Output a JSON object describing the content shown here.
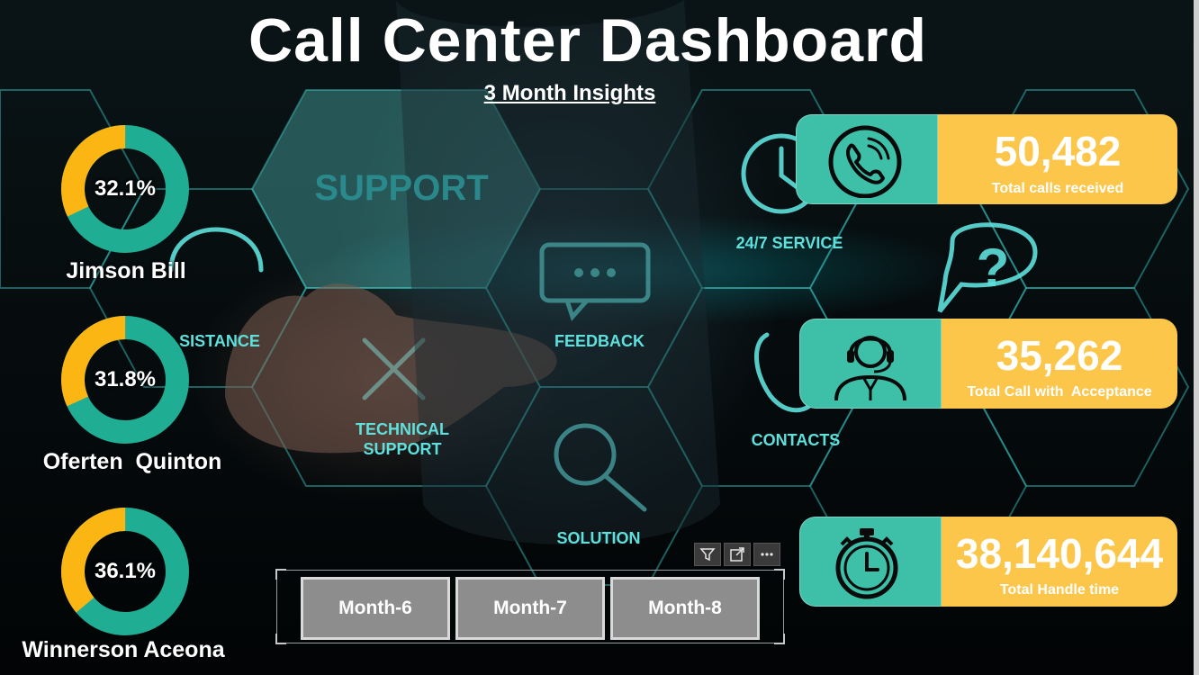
{
  "header": {
    "title": "Call Center Dashboard",
    "subtitle": "3 Month Insights"
  },
  "background_labels": {
    "support": "SUPPORT",
    "service": "24/7 SERVICE",
    "assistance": "SISTANCE",
    "feedback": "FEEDBACK",
    "technical_support_line1": "TECHNICAL",
    "technical_support_line2": "SUPPORT",
    "contacts": "CONTACTS",
    "solution": "SOLUTION"
  },
  "agents": [
    {
      "name": "Jimson Bill",
      "percent_label": "32.1%",
      "percent": 32.1
    },
    {
      "name": "Oferten  Quinton",
      "percent_label": "31.8%",
      "percent": 31.8
    },
    {
      "name": "Winnerson Aceona",
      "percent_label": "36.1%",
      "percent": 36.1
    }
  ],
  "kpis": [
    {
      "value": "50,482",
      "label": "Total calls received",
      "icon": "phone-icon"
    },
    {
      "value": "35,262",
      "label": "Total Call with  Acceptance",
      "icon": "call-agent-icon"
    },
    {
      "value": "38,140,644",
      "label": "Total Handle time",
      "icon": "stopwatch-icon"
    }
  ],
  "slicer": {
    "months": [
      "Month-6",
      "Month-7",
      "Month-8"
    ],
    "tools": [
      "filter-icon",
      "focus-mode-icon",
      "more-options-icon"
    ]
  },
  "colors": {
    "donut_primary": "#1fae93",
    "donut_secondary": "#fbb614",
    "kpi_yellow": "#fcc64b",
    "kpi_teal": "#3dbfa8",
    "slicer_button": "#8d8d8d",
    "hex_glow": "#4fd8d6"
  }
}
